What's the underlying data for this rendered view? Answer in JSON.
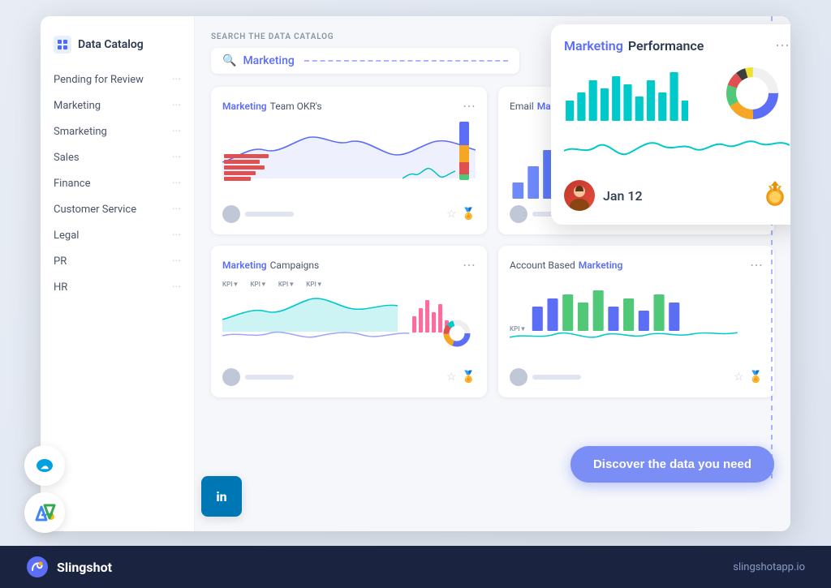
{
  "app": {
    "name": "Slingshot",
    "url": "slingshotapp.io",
    "icon_unicode": "🔗"
  },
  "sidebar": {
    "header": "Data Catalog",
    "items": [
      {
        "label": "Pending for Review",
        "id": "pending"
      },
      {
        "label": "Marketing",
        "id": "marketing"
      },
      {
        "label": "Smarketing",
        "id": "smarketing"
      },
      {
        "label": "Sales",
        "id": "sales"
      },
      {
        "label": "Finance",
        "id": "finance"
      },
      {
        "label": "Customer Service",
        "id": "customer-service"
      },
      {
        "label": "Legal",
        "id": "legal"
      },
      {
        "label": "PR",
        "id": "pr"
      },
      {
        "label": "HR",
        "id": "hr"
      }
    ]
  },
  "search": {
    "label": "SEARCH THE DATA CATALOG",
    "query": "Marketing",
    "placeholder": "Marketing"
  },
  "cards": [
    {
      "id": "marketing-team-okr",
      "title_highlight": "Marketing",
      "title_rest": "Team OKR's",
      "type": "okr"
    },
    {
      "id": "email-marketing",
      "title_highlight": "Email",
      "title_rest": "Marketing",
      "type": "email"
    },
    {
      "id": "marketing-campaigns",
      "title_highlight": "Marketing",
      "title_rest": "Campaigns",
      "type": "campaigns"
    },
    {
      "id": "account-based-marketing",
      "title_highlight": "Account Based",
      "title_rest": "Marketing",
      "type": "account"
    }
  ],
  "floating_card": {
    "title_highlight": "Marketing",
    "title_rest": "Performance",
    "date": "Jan 12"
  },
  "cta_button": {
    "label": "Discover the data you need"
  },
  "app_logos": [
    {
      "name": "Salesforce",
      "type": "circle",
      "color": "#00a1e0"
    },
    {
      "name": "Google Ads",
      "type": "circle"
    },
    {
      "name": "LinkedIn",
      "type": "square",
      "color": "#0077b5"
    }
  ]
}
